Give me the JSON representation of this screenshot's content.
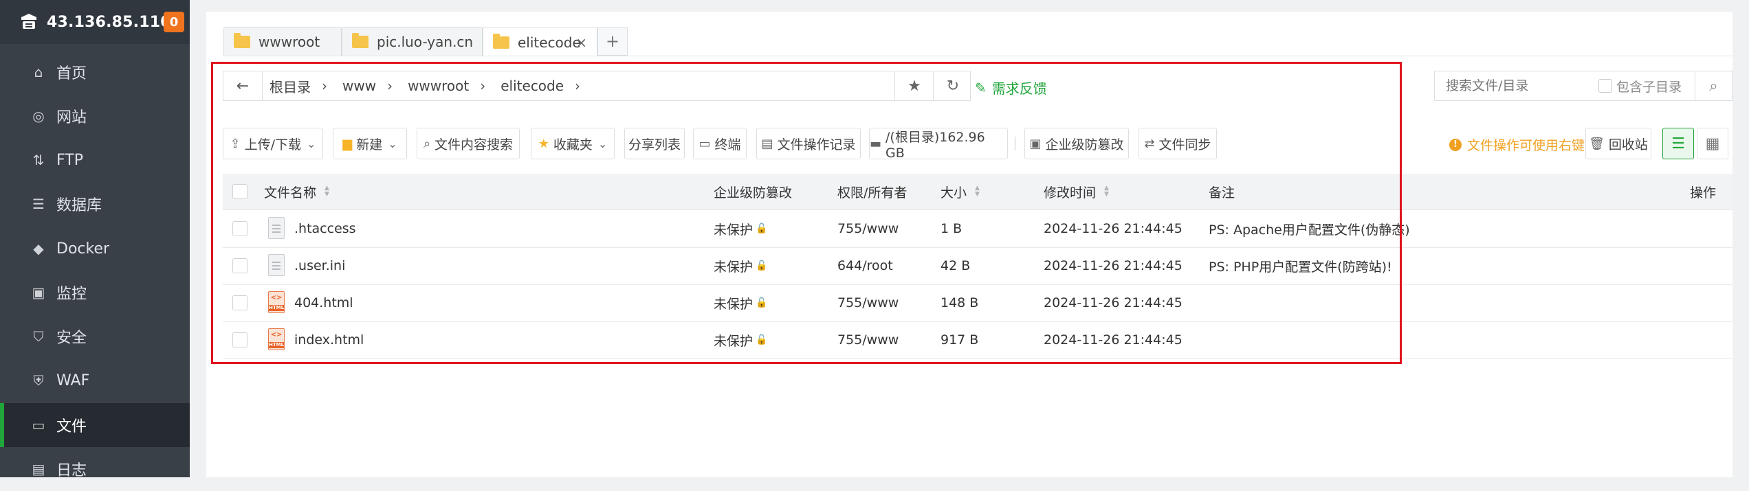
{
  "sidebar": {
    "ip": "43.136.85.110",
    "badge": "0",
    "items": [
      {
        "label": "首页",
        "icon": "home-icon"
      },
      {
        "label": "网站",
        "icon": "globe-icon"
      },
      {
        "label": "FTP",
        "icon": "ftp-icon"
      },
      {
        "label": "数据库",
        "icon": "database-icon"
      },
      {
        "label": "Docker",
        "icon": "docker-icon"
      },
      {
        "label": "监控",
        "icon": "monitor-icon"
      },
      {
        "label": "安全",
        "icon": "shield-icon"
      },
      {
        "label": "WAF",
        "icon": "waf-icon"
      },
      {
        "label": "文件",
        "icon": "folder-icon"
      },
      {
        "label": "日志",
        "icon": "log-icon"
      }
    ],
    "active_item": "文件"
  },
  "tabs": [
    {
      "label": "wwwroot",
      "active": false
    },
    {
      "label": "pic.luo-yan.cn",
      "active": false
    },
    {
      "label": "elitecode",
      "active": true
    }
  ],
  "tab_add": "+",
  "tab_close": "×",
  "path": {
    "crumbs": [
      "根目录",
      "www",
      "wwwroot",
      "elitecode"
    ],
    "feedback": "需求反馈"
  },
  "search": {
    "placeholder": "搜索文件/目录",
    "include_sub": "包含子目录"
  },
  "toolbar": {
    "upload": "上传/下载",
    "new": "新建",
    "content_search": "文件内容搜索",
    "favorites": "收藏夹",
    "share_list": "分享列表",
    "terminal": "终端",
    "op_log": "文件操作记录",
    "disk": "/(根目录)162.96 GB",
    "tamper": "企业级防篡改",
    "sync": "文件同步",
    "tip": "文件操作可使用右键",
    "recycle": "回收站"
  },
  "table": {
    "headers": {
      "name": "文件名称",
      "tamper": "企业级防篡改",
      "perm": "权限/所有者",
      "size": "大小",
      "mtime": "修改时间",
      "remark": "备注",
      "ops": "操作"
    },
    "rows": [
      {
        "name": ".htaccess",
        "type": "txt",
        "tamper": "未保护",
        "perm": "755/www",
        "size": "1 B",
        "mtime": "2024-11-26 21:44:45",
        "remark": "PS: Apache用户配置文件(伪静态)"
      },
      {
        "name": ".user.ini",
        "type": "txt",
        "tamper": "未保护",
        "perm": "644/root",
        "size": "42 B",
        "mtime": "2024-11-26 21:44:45",
        "remark": "PS: PHP用户配置文件(防跨站)!"
      },
      {
        "name": "404.html",
        "type": "html",
        "tamper": "未保护",
        "perm": "755/www",
        "size": "148 B",
        "mtime": "2024-11-26 21:44:45",
        "remark": ""
      },
      {
        "name": "index.html",
        "type": "html",
        "tamper": "未保护",
        "perm": "755/www",
        "size": "917 B",
        "mtime": "2024-11-26 21:44:45",
        "remark": ""
      }
    ]
  },
  "colors": {
    "accent": "#20a53a",
    "highlight": "#e0141e",
    "warning": "#f0a020",
    "badge": "#f0731e"
  }
}
